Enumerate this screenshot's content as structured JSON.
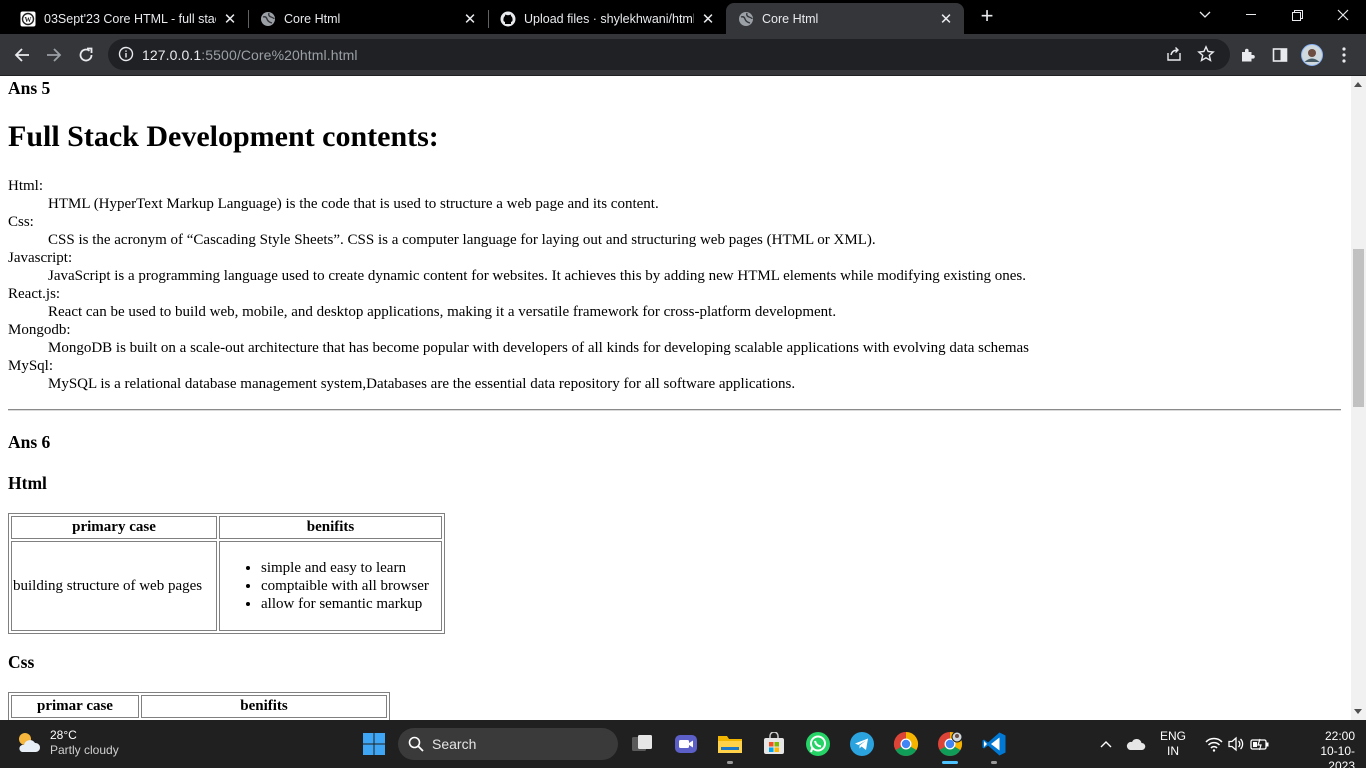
{
  "browser": {
    "tabs": [
      {
        "title": "03Sept'23 Core HTML - full stack",
        "icon": "wordpress-icon",
        "active": false
      },
      {
        "title": "Core Html",
        "icon": "globe-icon",
        "active": false
      },
      {
        "title": "Upload files · shylekhwani/html-",
        "icon": "github-icon",
        "active": false
      },
      {
        "title": "Core Html",
        "icon": "globe-icon",
        "active": true
      }
    ],
    "url_host": "127.0.0.1",
    "url_rest": ":5500/Core%20html.html"
  },
  "page": {
    "ans5": "Ans 5",
    "heading": "Full Stack Development contents:",
    "definitions": [
      {
        "term": "Html:",
        "desc": "HTML (HyperText Markup Language) is the code that is used to structure a web page and its content."
      },
      {
        "term": "Css:",
        "desc": "CSS is the acronym of “Cascading Style Sheets”. CSS is a computer language for laying out and structuring web pages (HTML or XML)."
      },
      {
        "term": "Javascript:",
        "desc": "JavaScript is a programming language used to create dynamic content for websites. It achieves this by adding new HTML elements while modifying existing ones."
      },
      {
        "term": "React.js:",
        "desc": "React can be used to build web, mobile, and desktop applications, making it a versatile framework for cross-platform development."
      },
      {
        "term": "Mongodb:",
        "desc": "MongoDB is built on a scale-out architecture that has become popular with developers of all kinds for developing scalable applications with evolving data schemas"
      },
      {
        "term": "MySql:",
        "desc": "MySQL is a relational database management system,Databases are the essential data repository for all software applications."
      }
    ],
    "ans6": "Ans 6",
    "html_heading": "Html",
    "html_table": {
      "headers": [
        "primary case",
        "benifits"
      ],
      "case": "building structure of web pages",
      "benefits": [
        "simple and easy to learn",
        "comptaible with all browser",
        "allow for semantic markup"
      ]
    },
    "css_heading": "Css",
    "css_table": {
      "headers": [
        "primar case",
        "benifits"
      ]
    }
  },
  "taskbar": {
    "temperature": "28°C",
    "condition": "Partly cloudy",
    "search_label": "Search",
    "lang_top": "ENG",
    "lang_bottom": "IN",
    "time": "22:00",
    "date": "10-10-2023"
  }
}
